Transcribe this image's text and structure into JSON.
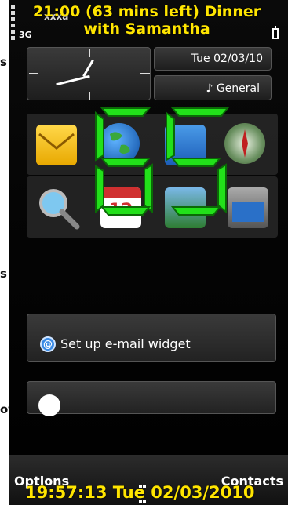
{
  "overlay_note": "21:00 (63 mins left) Dinner with Samantha",
  "status": {
    "network": "3G",
    "operator": "xxxa",
    "battery_label": ""
  },
  "clock_widget": {
    "date": "Tue 02/03/10",
    "profile": "♪ General"
  },
  "countdown_digits": "65",
  "apps_row1": [
    "messaging-icon",
    "web-icon",
    "ovi-store-icon",
    "maps-icon"
  ],
  "apps_row2": [
    "search-icon",
    "calendar-icon",
    "photos-icon",
    "video-icon"
  ],
  "calendar_day": "12",
  "email_widget": {
    "label": "Set up e-mail widget",
    "icon_letter": "@"
  },
  "softkeys": {
    "left": "Options",
    "right": "Contacts"
  },
  "bottom_overlay": "19:57:13 Tue 02/03/2010",
  "side_clips": [
    "s",
    "s",
    "of"
  ],
  "colors": {
    "overlay_yellow": "#ffe500",
    "digit_green": "#22e01a",
    "background": "#000000"
  }
}
